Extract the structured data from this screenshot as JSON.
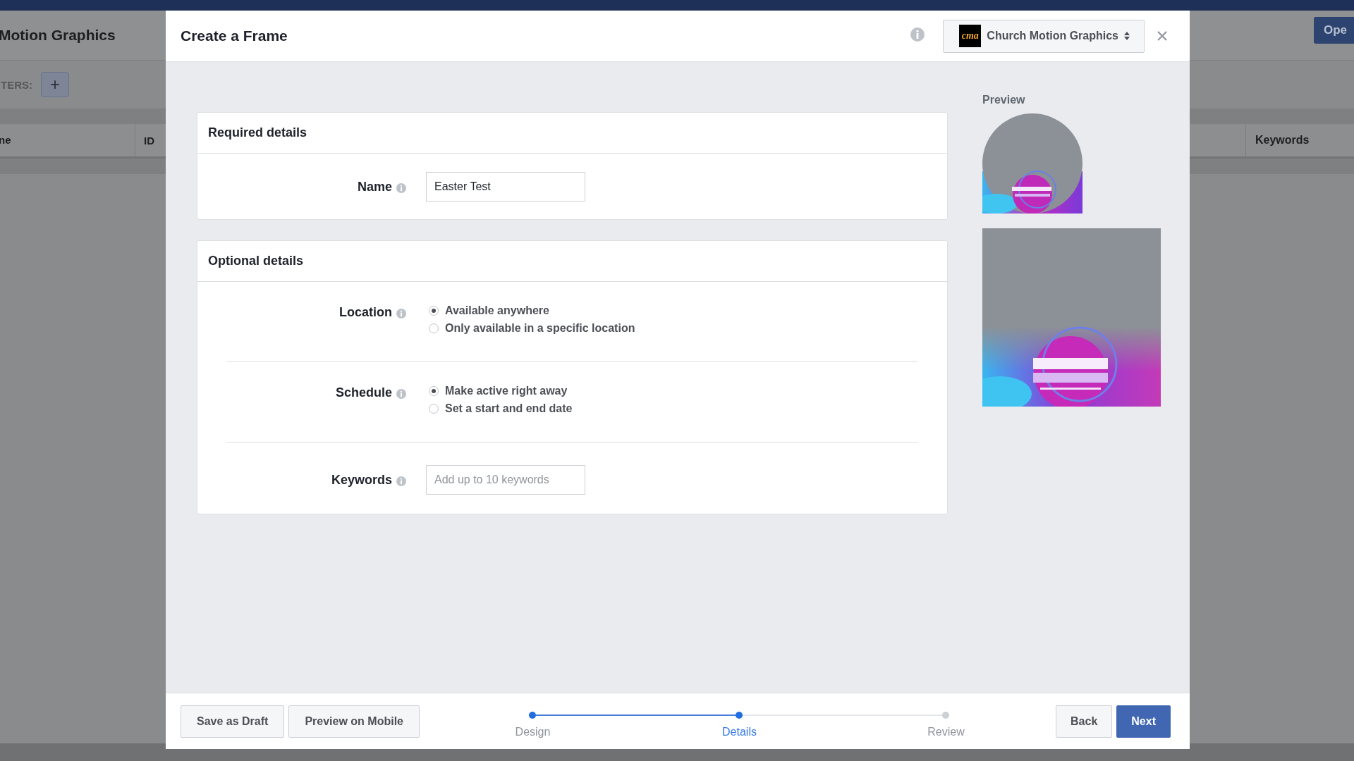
{
  "background": {
    "title": "Motion Graphics",
    "open_button": "Ope",
    "filters_label": "TERS:",
    "add_button": "+",
    "columns": [
      "ne",
      "ID"
    ],
    "right_column": "Keywords"
  },
  "dialog": {
    "title": "Create a Frame",
    "page_logo": "cma",
    "page_selector": "Church Motion Graphics"
  },
  "required": {
    "title": "Required details",
    "label": "Name",
    "value": "Easter Test"
  },
  "optional": {
    "title": "Optional details",
    "rows": [
      {
        "kind": "radio",
        "label": "Location",
        "options": [
          {
            "label": "Available anywhere",
            "selected": true
          },
          {
            "label": "Only available in a specific location",
            "selected": false
          }
        ]
      },
      {
        "kind": "radio",
        "label": "Schedule",
        "options": [
          {
            "label": "Make active right away",
            "selected": true
          },
          {
            "label": "Set a start and end date",
            "selected": false
          }
        ]
      },
      {
        "kind": "text",
        "label": "Keywords",
        "placeholder": "Add up to 10 keywords"
      }
    ]
  },
  "preview": {
    "title": "Preview"
  },
  "footer": {
    "buttons": [
      "Save as Draft",
      "Preview on Mobile"
    ],
    "steps": [
      {
        "label": "Design",
        "done": true,
        "selected": false
      },
      {
        "label": "Details",
        "done": true,
        "selected": true
      },
      {
        "label": "Review",
        "done": false,
        "selected": false
      }
    ],
    "back": "Back",
    "next": "Next"
  }
}
